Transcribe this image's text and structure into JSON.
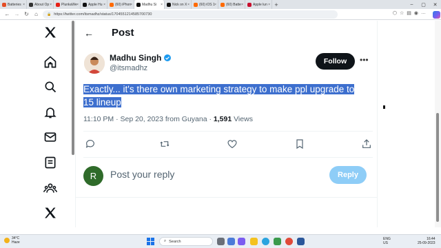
{
  "browser": {
    "tabs": [
      {
        "label": "Batteries",
        "color": "#e44d26"
      },
      {
        "label": "About Op",
        "color": "#333333"
      },
      {
        "label": "PlunkaWe",
        "color": "#e62117"
      },
      {
        "label": "Apple Hu",
        "color": "#111111"
      },
      {
        "label": "(60) iPhon",
        "color": "#ff6a00"
      },
      {
        "label": "Madhu Si",
        "color": "#111111"
      },
      {
        "label": "Nick on X",
        "color": "#111111"
      },
      {
        "label": "(60) iOS 1",
        "color": "#ff6a00"
      },
      {
        "label": "(60) Batte",
        "color": "#ff6a00"
      },
      {
        "label": "Apple lun",
        "color": "#c8102e"
      }
    ],
    "active_tab_index": 5,
    "new_tab": "+",
    "window_controls": {
      "minimize": "–",
      "maximize": "▢",
      "close": "✕"
    },
    "url": "https://twitter.com/itsmadhz/status/1704551214585700730"
  },
  "rail": {
    "icons": [
      "x-logo-icon",
      "home-icon",
      "search-icon",
      "notifications-icon",
      "messages-icon",
      "lists-icon",
      "communities-icon",
      "premium-x-icon"
    ]
  },
  "header": {
    "back": "←",
    "title": "Post"
  },
  "post": {
    "author_name": "Madhu Singh",
    "author_handle": "@itsmadhz",
    "follow_label": "Follow",
    "more": "•••",
    "text": "Exactly... it's there own marketing strategy to make ppl upgrade to 15 lineup",
    "time": "11:10 PM · Sep 20, 2023 from Guyana · ",
    "views_count": "1,591",
    "views_label": " Views",
    "verified_color": "#1d9bf0"
  },
  "reply": {
    "avatar_letter": "R",
    "placeholder": "Post your reply",
    "button": "Reply"
  },
  "taskbar": {
    "weather_temp": "34°C",
    "weather_desc": "Haze",
    "search_placeholder": "Search",
    "lang": "ENG",
    "region": "US",
    "time": "16:44",
    "date": "25-09-2023"
  }
}
